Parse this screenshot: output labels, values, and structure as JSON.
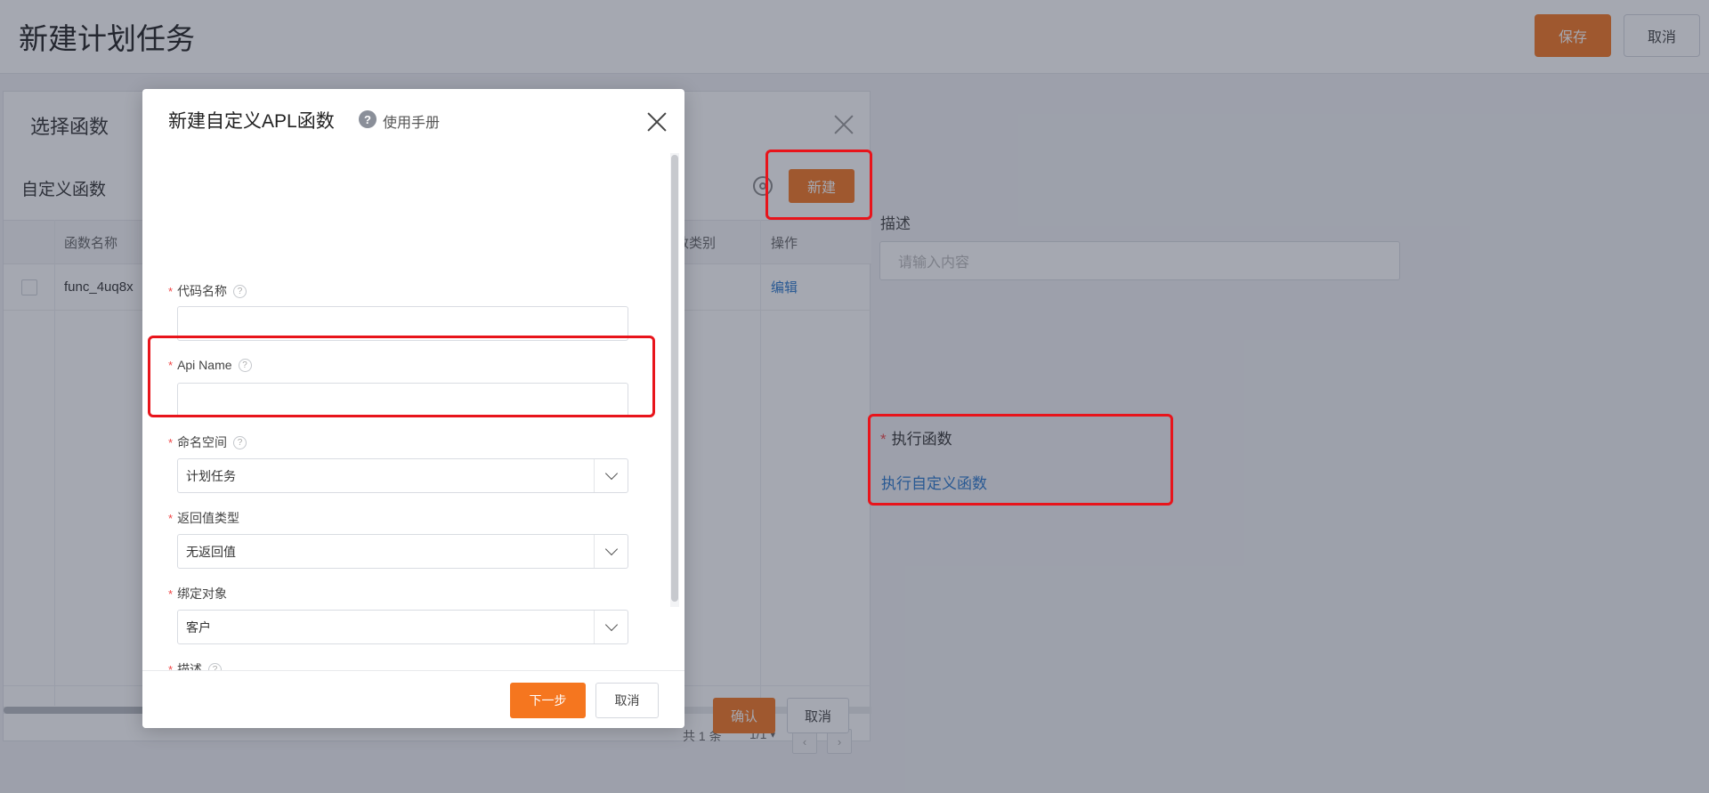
{
  "header": {
    "title": "新建计划任务",
    "save_label": "保存",
    "cancel_label": "取消"
  },
  "form": {
    "description_label": "描述",
    "description_placeholder": "请输入内容",
    "exec_label": "执行函数",
    "exec_link": "执行自定义函数"
  },
  "select_panel": {
    "title": "选择函数",
    "subtitle": "自定义函数",
    "new_label": "新建",
    "columns": [
      "函数名称",
      "函数类别",
      "操作"
    ],
    "rows": [
      {
        "name": "func_4uq8x",
        "category": "",
        "action": "编辑"
      }
    ],
    "pager": {
      "total": "共 1 条",
      "page": "1/1"
    },
    "ok_label": "确认",
    "cancel_label": "取消"
  },
  "modal": {
    "title": "新建自定义APL函数",
    "help_label": "使用手册",
    "fields": {
      "code_name": {
        "label": "代码名称",
        "value": ""
      },
      "api_name": {
        "label": "Api Name",
        "value": ""
      },
      "namespace": {
        "label": "命名空间",
        "value": "计划任务"
      },
      "return_type": {
        "label": "返回值类型",
        "value": "无返回值"
      },
      "bind_object": {
        "label": "绑定对象",
        "value": "客户"
      },
      "description": {
        "label": "描述",
        "value": ""
      }
    },
    "next_label": "下一步",
    "cancel_label": "取消"
  },
  "colors": {
    "accent": "#f5761f",
    "link": "#2a78cc",
    "annotation": "#e8141b"
  }
}
